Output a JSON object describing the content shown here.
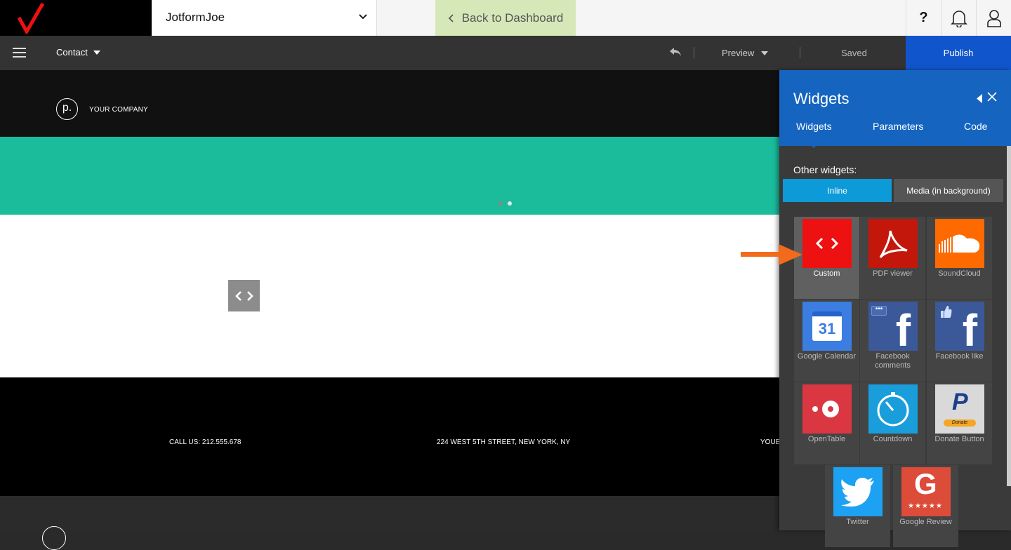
{
  "topbar": {
    "account_name": "JotformJoe",
    "back_label": "Back to Dashboard"
  },
  "toolbar": {
    "page_name": "Contact",
    "preview_label": "Preview",
    "saved_label": "Saved",
    "publish_label": "Publish"
  },
  "site": {
    "company_mark": "p.",
    "company_name": "YOUR COMPANY",
    "footer": {
      "phone": "CALL US: 212.555.678",
      "address": "224 WEST 5TH STREET, NEW YORK, NY",
      "partial": "YOUE"
    }
  },
  "panel": {
    "title": "Widgets",
    "tabs": [
      "Widgets",
      "Parameters",
      "Code"
    ],
    "other_label": "Other widgets:",
    "segments": [
      "Inline",
      "Media (in background)"
    ],
    "widgets": [
      {
        "label": "Custom",
        "color": "#ee1111"
      },
      {
        "label": "PDF viewer",
        "color": "#c4170b"
      },
      {
        "label": "SoundCloud",
        "color": "#ff6a00"
      },
      {
        "label": "Google Calendar",
        "color": "#3b7de0",
        "badge": "31"
      },
      {
        "label": "Facebook comments",
        "color": "#3b5998"
      },
      {
        "label": "Facebook like",
        "color": "#3b5998"
      },
      {
        "label": "OpenTable",
        "color": "#da3743"
      },
      {
        "label": "Countdown",
        "color": "#1a9ddb"
      },
      {
        "label": "Donate Button",
        "color": "#d9d9d9",
        "badge": "Donate"
      },
      {
        "label": "Twitter",
        "color": "#1da1f2"
      },
      {
        "label": "Google Review",
        "color": "#dd4b39",
        "badge": "★★★★★"
      }
    ]
  }
}
